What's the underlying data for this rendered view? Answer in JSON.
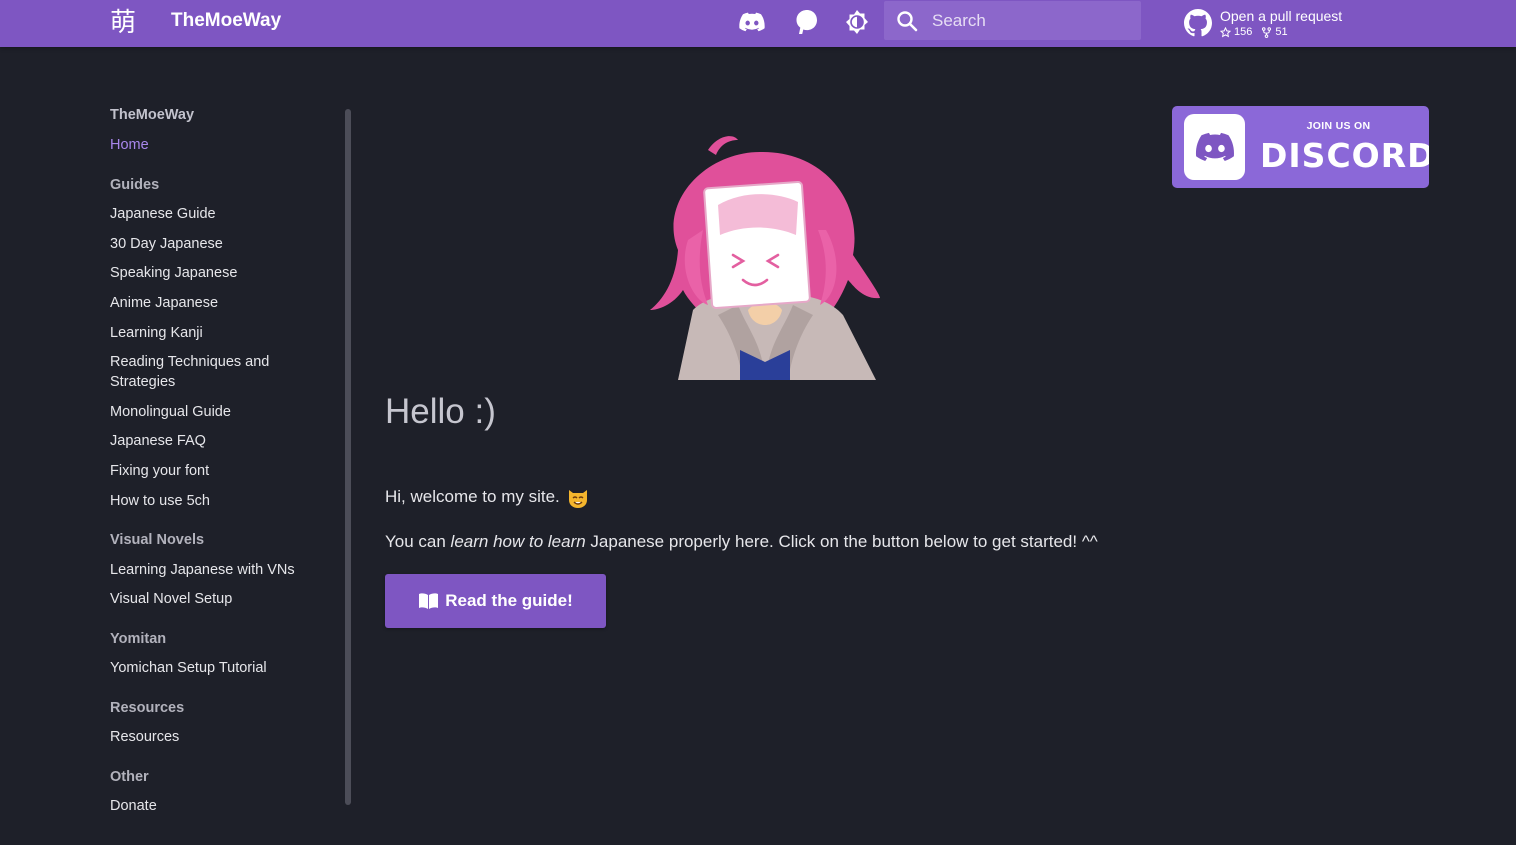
{
  "header": {
    "logo_glyph": "萌",
    "site_title": "TheMoeWay",
    "icons": [
      "discord-icon",
      "patreon-icon",
      "theme-toggle-icon"
    ],
    "search": {
      "placeholder": "Search"
    },
    "repo": {
      "label": "Open a pull request",
      "stars": "156",
      "forks": "51"
    },
    "accent": "#7e56c2"
  },
  "sidebar": {
    "site_name": "TheMoeWay",
    "home": "Home",
    "sections": [
      {
        "title": "Guides",
        "items": [
          "Japanese Guide",
          "30 Day Japanese",
          "Speaking Japanese",
          "Anime Japanese",
          "Learning Kanji",
          "Reading Techniques and Strategies",
          "Monolingual Guide",
          "Japanese FAQ",
          "Fixing your font",
          "How to use 5ch"
        ]
      },
      {
        "title": "Visual Novels",
        "items": [
          "Learning Japanese with VNs",
          "Visual Novel Setup"
        ]
      },
      {
        "title": "Yomitan",
        "items": [
          "Yomichan Setup Tutorial"
        ]
      },
      {
        "title": "Resources",
        "items": [
          "Resources"
        ]
      },
      {
        "title": "Other",
        "items": [
          "Donate"
        ]
      }
    ]
  },
  "main": {
    "heading": "Hello :)",
    "welcome": "Hi, welcome to my site.",
    "welcome_emoji": "smiling-cat-icon",
    "intro_before": "You can ",
    "intro_em": "learn how to learn",
    "intro_after": " Japanese properly here. Click on the button below to get started! ^^",
    "button_label": "Read the guide!",
    "discord_banner": {
      "top": "JOIN US ON",
      "word": "DISCORD"
    }
  }
}
